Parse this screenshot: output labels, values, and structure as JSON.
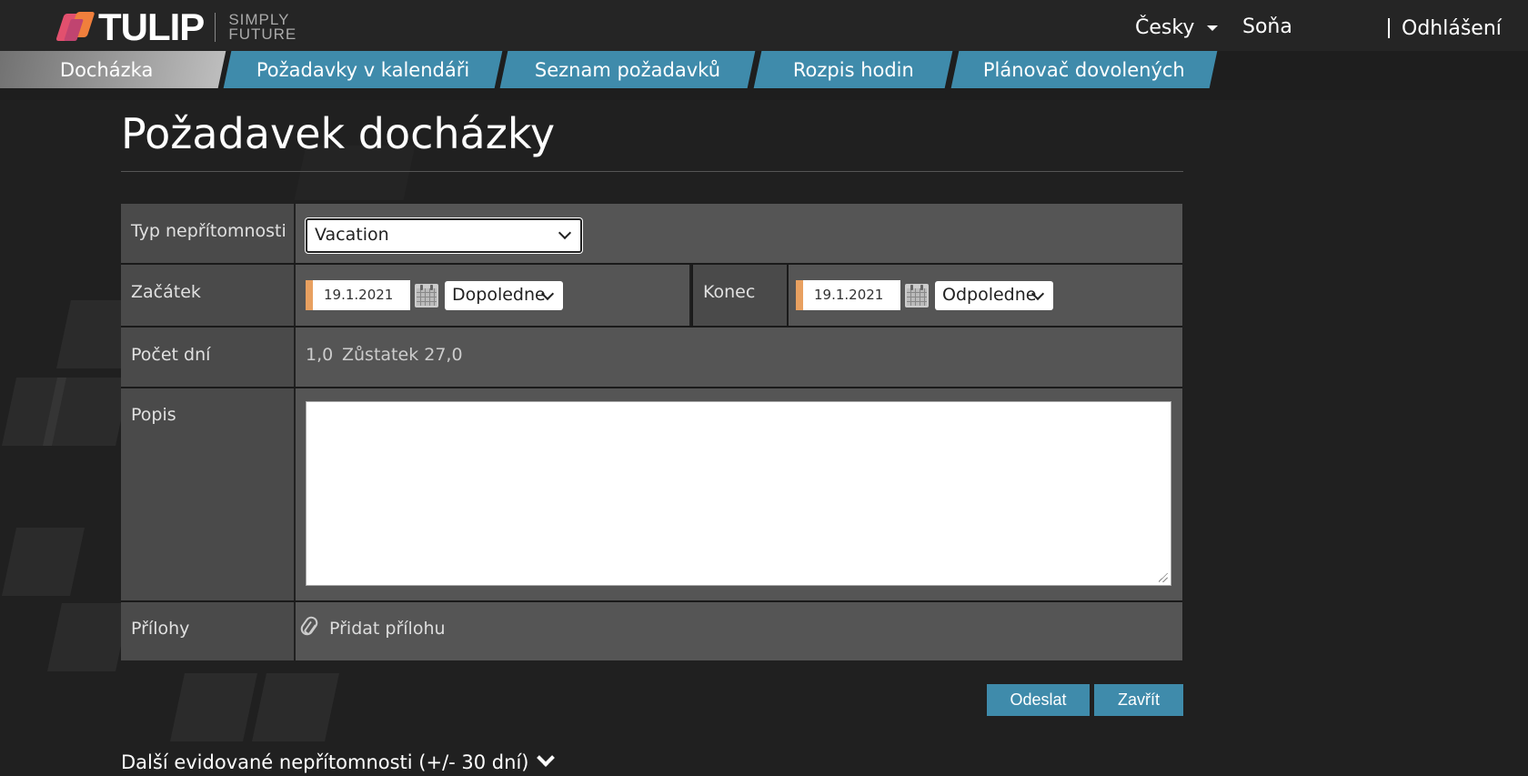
{
  "header": {
    "logo_word": "TULIP",
    "logo_tagline_line1": "SIMPLY",
    "logo_tagline_line2": "FUTURE",
    "language": "Česky",
    "user": "Soňa",
    "logout": "Odhlášení"
  },
  "nav": {
    "tabs": [
      {
        "label": "Docházka",
        "active": true
      },
      {
        "label": "Požadavky v kalendáři",
        "active": false
      },
      {
        "label": "Seznam požadavků",
        "active": false
      },
      {
        "label": "Rozpis hodin",
        "active": false
      },
      {
        "label": "Plánovač dovolených",
        "active": false
      }
    ]
  },
  "page": {
    "title": "Požadavek docházky"
  },
  "form": {
    "absence_type": {
      "label": "Typ nepřítomnosti",
      "value": "Vacation"
    },
    "start": {
      "label": "Začátek",
      "date": "19.1.2021",
      "half": "Dopoledne"
    },
    "end": {
      "label": "Konec",
      "date": "19.1.2021",
      "half": "Odpoledne"
    },
    "days": {
      "label": "Počet dní",
      "value": "1,0",
      "balance": "Zůstatek 27,0"
    },
    "description": {
      "label": "Popis",
      "value": ""
    },
    "attachments": {
      "label": "Přílohy",
      "add_label": "Přidat přílohu"
    }
  },
  "actions": {
    "submit": "Odeslat",
    "close": "Zavřít"
  },
  "other_absences": {
    "label": "Další evidované nepřítomnosti (+/- 30 dní)"
  },
  "colors": {
    "accent_blue": "#3f8bab",
    "required_marker": "#e8a060"
  }
}
